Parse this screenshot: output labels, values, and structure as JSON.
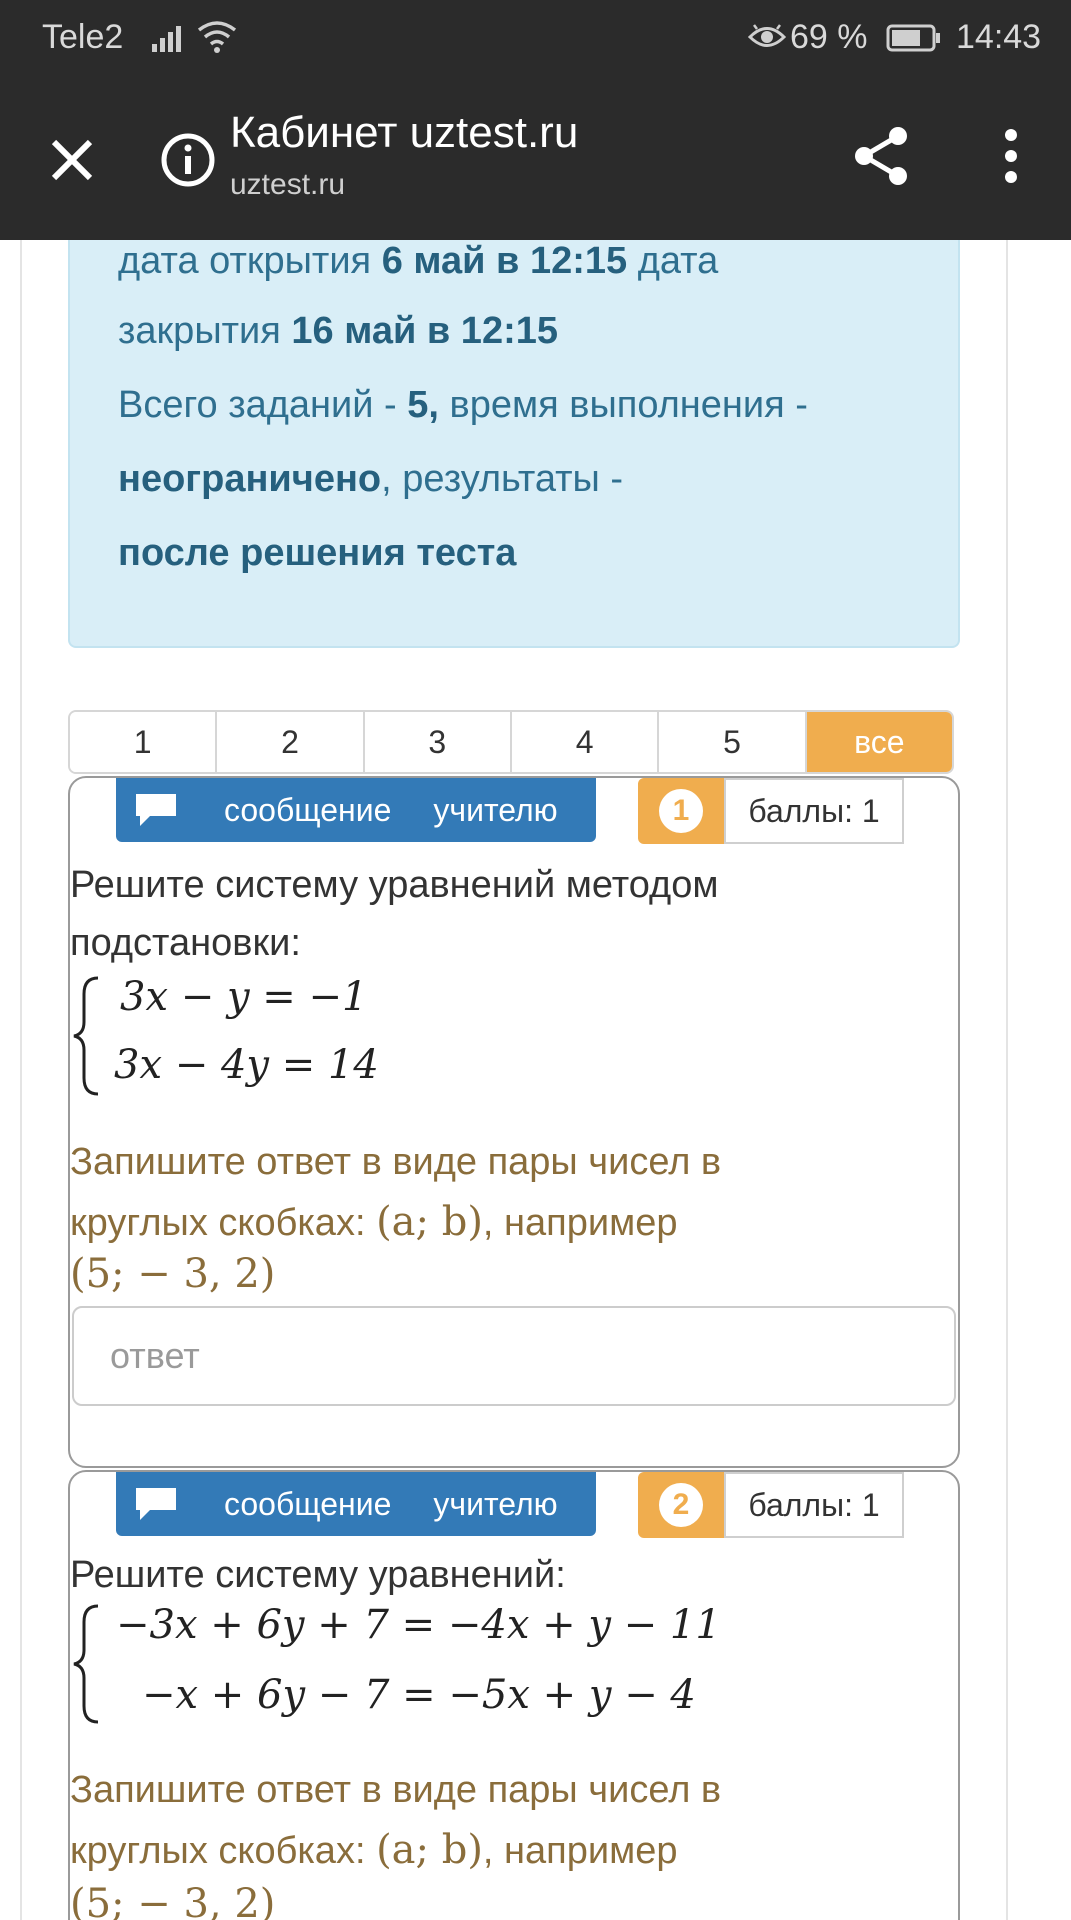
{
  "status_bar": {
    "carrier": "Tele2",
    "battery_percent": "69 %",
    "time": "14:43",
    "icons": [
      "signal-icon",
      "wifi-icon",
      "eye-comfort-icon",
      "battery-icon"
    ]
  },
  "browser": {
    "title": "Кабинет uztest.ru",
    "domain": "uztest.ru",
    "icons": [
      "close-icon",
      "info-icon",
      "share-icon",
      "more-vert-icon"
    ]
  },
  "info": {
    "open_prefix": "дата открытия ",
    "open_value": "6 май в 12:15",
    "open_suffix": " дата",
    "close_prefix": "закрытия ",
    "close_value": "16 май в 12:15",
    "tasks_prefix": "Всего заданий - ",
    "tasks_value": "5,",
    "time_prefix": " время выполнения -",
    "time_value": "неограничено",
    "results_prefix": ", результаты -",
    "results_value": "после решения теста"
  },
  "pager": {
    "items": [
      "1",
      "2",
      "3",
      "4",
      "5",
      "все"
    ],
    "active": "все"
  },
  "tasks": [
    {
      "number": "1",
      "message_btn": [
        "сообщение",
        "учителю"
      ],
      "points_label": "баллы: 1",
      "question_lines": [
        "Решите систему уравнений методом",
        "подстановки:"
      ],
      "equations": [
        "3x − y = −1",
        "3x − 4y = 14"
      ],
      "hint_line1": "Запишите ответ в виде пары чисел в",
      "hint_line2_text": "круглых скобках: ",
      "hint_line2_math": "(a; b)",
      "hint_line2_tail": ", например",
      "hint_example": "(5;  − 3, 2)",
      "answer_placeholder": "ответ"
    },
    {
      "number": "2",
      "message_btn": [
        "сообщение",
        "учителю"
      ],
      "points_label": "баллы: 1",
      "question_lines": [
        "Решите систему уравнений:"
      ],
      "equations": [
        "−3x + 6y + 7 = −4x + y − 11",
        "−x + 6y − 7 = −5x + y − 4"
      ],
      "hint_line1": "Запишите ответ в виде пары чисел в",
      "hint_line2_text": "круглых скобках: ",
      "hint_line2_math": "(a; b)",
      "hint_line2_tail": ", например",
      "hint_example": "(5;  − 3, 2)"
    }
  ],
  "colors": {
    "topbar": "#2b2b2b",
    "info_bg": "#d9eef7",
    "info_text": "#2f6f8f",
    "accent_orange": "#f0ad4e",
    "message_blue": "#337ab7",
    "hint_brown": "#8a6d3b"
  }
}
